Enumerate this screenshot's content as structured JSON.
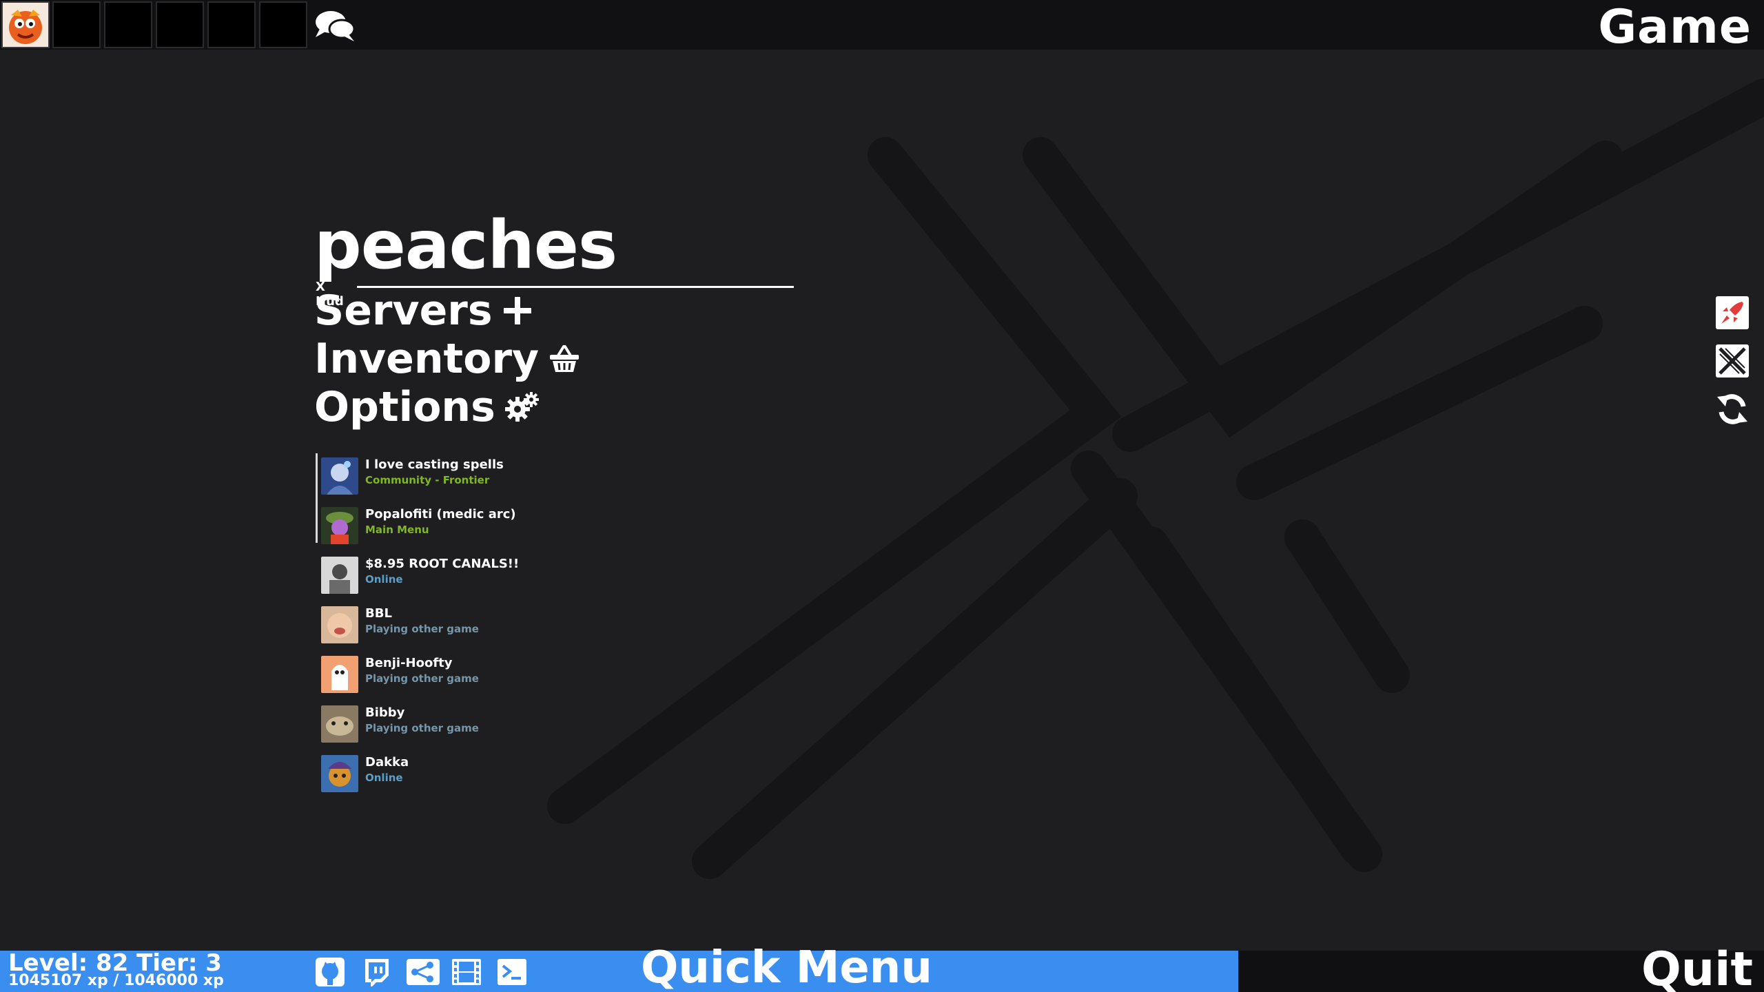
{
  "top_bar": {
    "game_title": "Game",
    "chat_icon": "chat-bubbles-icon",
    "party_slots": [
      "me",
      "",
      "",
      "",
      "",
      ""
    ]
  },
  "main_menu": {
    "player_name": "peaches",
    "hud_label": "X Hud",
    "servers_label": "Servers",
    "servers_icon": "plus-icon",
    "inventory_label": "Inventory",
    "inventory_icon": "basket-icon",
    "options_label": "Options",
    "options_icon": "gears-icon"
  },
  "friends": [
    {
      "name": "I love casting spells",
      "status": "Community - Frontier",
      "state": "ingame"
    },
    {
      "name": "Popalofiti (medic arc)",
      "status": "Main Menu",
      "state": "ingame"
    },
    {
      "name": "$8.95 ROOT CANALS!!",
      "status": "Online",
      "state": "online"
    },
    {
      "name": "BBL",
      "status": "Playing other game",
      "state": "other"
    },
    {
      "name": "Benji-Hoofty",
      "status": "Playing other game",
      "state": "other"
    },
    {
      "name": "Bibby",
      "status": "Playing other game",
      "state": "other"
    },
    {
      "name": "Dakka",
      "status": "Online",
      "state": "online"
    }
  ],
  "side_icons": [
    "rocket-icon",
    "x-logo-icon",
    "refresh-icon"
  ],
  "bottom_bar": {
    "level_text": "Level: 82 Tier: 3",
    "xp_text": "1045107 xp / 1046000 xp",
    "icons": [
      "github-icon",
      "twitch-icon",
      "share-icon",
      "film-icon",
      "terminal-icon"
    ],
    "quick_menu_label": "Quick Menu",
    "quit_label": "Quit"
  },
  "colors": {
    "accent_blue": "#3a8ef0",
    "background": "#1e1e21",
    "status_ingame": "#7fb81f",
    "status_online": "#5b9fc9",
    "status_other": "#7596a8"
  }
}
